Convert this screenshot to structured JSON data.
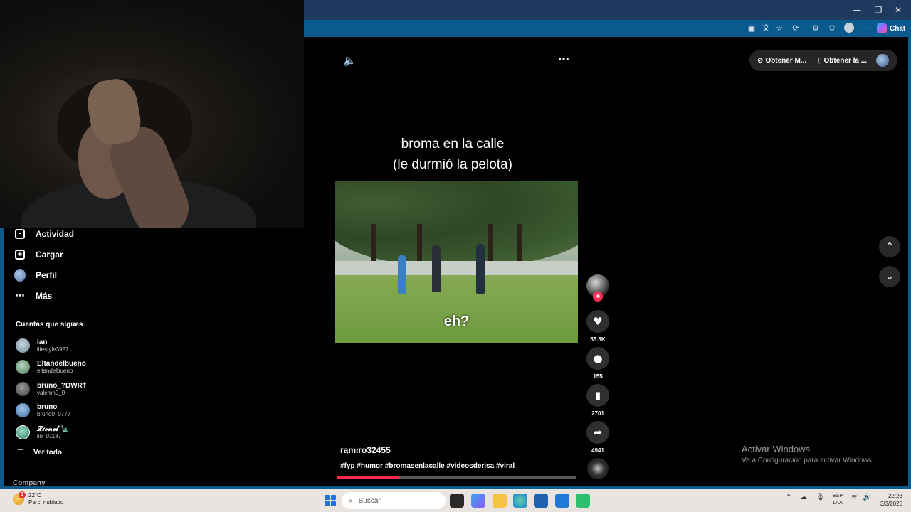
{
  "browser": {
    "chat_label": "Chat",
    "window_controls": [
      "minimize-icon",
      "maximize-icon",
      "close-icon"
    ]
  },
  "sidebar": {
    "items": [
      {
        "label": "Actividad",
        "icon": "activity-icon"
      },
      {
        "label": "Cargar",
        "icon": "upload-icon"
      },
      {
        "label": "Perfil",
        "icon": "profile-avatar"
      },
      {
        "label": "Más",
        "icon": "more-icon"
      }
    ],
    "following_title": "Cuentas que sigues",
    "following": [
      {
        "name": "Ian",
        "username": "lifestyle3957"
      },
      {
        "name": "Eltandelbueno",
        "username": "eltandelbueno"
      },
      {
        "name": "bruno_?DWR†",
        "username": "valemn0_0"
      },
      {
        "name": "bruno",
        "username": "bruno0_0777"
      },
      {
        "name": "𝓛𝓲𝓸𝓷𝓮𝓵 🗽",
        "username": "lio_01187"
      }
    ],
    "see_all": "Ver todo",
    "company": "Company"
  },
  "player": {
    "caption_line1": "broma en la calle",
    "caption_line2": "(le durmió la pelota)",
    "subtitle": "eh?",
    "author": "ramiro32455",
    "hashtags": "#fyp #humor #bromasenlacalle #videosderisa #viral",
    "progress": 0.26,
    "likes": "55.5K",
    "comments": "155",
    "saves": "2701",
    "shares": "4941",
    "follow_plus": "+"
  },
  "header_pills": {
    "get_coins": "Obtener M...",
    "get_app": "Obtener la ..."
  },
  "nav": {
    "up": "⌃",
    "down": "⌄"
  },
  "watermark": {
    "title": "Activar Windows",
    "subtitle": "Ve a Configuración para activar Windows."
  },
  "taskbar": {
    "weather_badge": "3",
    "temperature": "22°C",
    "weather_text": "Parc. nublado",
    "search_placeholder": "Buscar",
    "lang_line1": "ESP",
    "lang_line2": "LAA",
    "time": "22:23",
    "date": "3/3/2026"
  }
}
